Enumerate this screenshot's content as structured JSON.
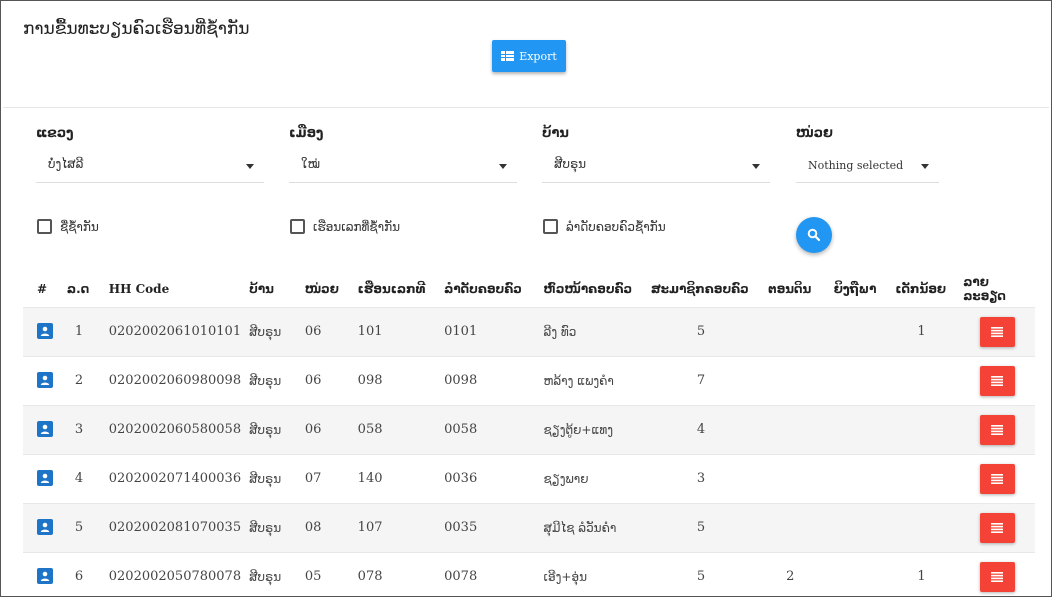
{
  "page": {
    "title": "ການຂື້ນທະບຽນຄົວເຮືອນທີ່ຊ້ຳກັນ",
    "export_label": "Export"
  },
  "filters": [
    {
      "label": "ແຂວງ",
      "value": "ບໍ່ງໄສລີ"
    },
    {
      "label": "ເມືອງ",
      "value": "ໃໝ່"
    },
    {
      "label": "ບ້ານ",
      "value": "ສີບຣຸນ"
    },
    {
      "label": "ໜ່ວຍ",
      "value": "Nothing selected"
    }
  ],
  "checkboxes": [
    {
      "label": "ຊື່ຊ້ຳກັນ",
      "checked": false
    },
    {
      "label": "ເຮືອນເລກທີ່ຊ້ຳກັນ",
      "checked": false
    },
    {
      "label": "ລຳດັບຄອບຄົວຊ້ຳກັນ",
      "checked": false
    }
  ],
  "table": {
    "headers": [
      "#",
      "ລ.ດ",
      "HH Code",
      "ບ້ານ",
      "ໜ່ວຍ",
      "ເຮືອນເລກທີ",
      "ລຳດັບຄອບຄົວ",
      "ຫົວໜ້າຄອບຄົວ",
      "ສະມາຊິກຄອບຄົວ",
      "ຕອນດິນ",
      "ຍິງຖືພາ",
      "ເດັກນ້ອຍ",
      "ລາຍລະອຽດ"
    ],
    "rows": [
      {
        "no": "1",
        "hh": "0202002061010101",
        "village": "ສີບຣຸນ",
        "unit": "06",
        "house": "101",
        "order": "0101",
        "head": "ລີງ ທົວ",
        "members": "5",
        "land": "",
        "pregnant": "",
        "children": "1"
      },
      {
        "no": "2",
        "hh": "0202002060980098",
        "village": "ສີບຣຸນ",
        "unit": "06",
        "house": "098",
        "order": "0098",
        "head": "ຫລ້າງ ແພງຄຳ",
        "members": "7",
        "land": "",
        "pregnant": "",
        "children": ""
      },
      {
        "no": "3",
        "hh": "0202002060580058",
        "village": "ສີບຣຸນ",
        "unit": "06",
        "house": "058",
        "order": "0058",
        "head": "ຊຽງຕູ້ຍ+ແທງ",
        "members": "4",
        "land": "",
        "pregnant": "",
        "children": ""
      },
      {
        "no": "4",
        "hh": "0202002071400036",
        "village": "ສີບຣຸນ",
        "unit": "07",
        "house": "140",
        "order": "0036",
        "head": "ຊຽງພາຍ",
        "members": "3",
        "land": "",
        "pregnant": "",
        "children": ""
      },
      {
        "no": "5",
        "hh": "0202002081070035",
        "village": "ສີບຣຸນ",
        "unit": "08",
        "house": "107",
        "order": "0035",
        "head": "ສຸມີໄຊ ລໍວັນຄຳ",
        "members": "5",
        "land": "",
        "pregnant": "",
        "children": ""
      },
      {
        "no": "6",
        "hh": "0202002050780078",
        "village": "ສີບຣຸນ",
        "unit": "05",
        "house": "078",
        "order": "0078",
        "head": "ເອີງ+ອຸ່ນ",
        "members": "5",
        "land": "2",
        "pregnant": "",
        "children": "1"
      }
    ]
  },
  "colors": {
    "primary": "#2196f3",
    "danger": "#f44336",
    "user_icon": "#1e74c7"
  },
  "icons": {
    "export": "table-icon",
    "search": "search-icon",
    "row": "user-icon",
    "detail": "list-icon"
  }
}
